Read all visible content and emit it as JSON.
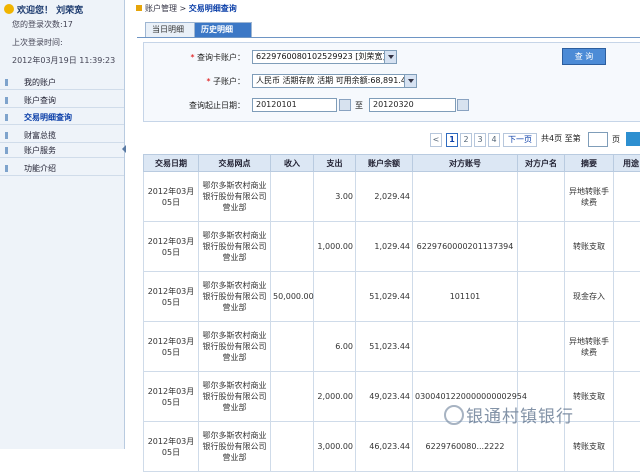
{
  "sidebar": {
    "welcome": "欢迎您！ 刘荣宽",
    "login_count": "您的登录次数:17",
    "last_login_label": "上次登录时间:",
    "last_login_time": "2012年03月19日 11:39:23",
    "items": [
      {
        "label": "我的账户"
      },
      {
        "label": "账户查询"
      },
      {
        "label": "交易明细查询"
      },
      {
        "label": "财富总揽"
      },
      {
        "label": "账户服务"
      },
      {
        "label": "功能介绍"
      }
    ]
  },
  "breadcrumb": {
    "parent": "账户管理",
    "sep": ">",
    "current": "交易明细查询"
  },
  "tabs": [
    {
      "label": "当日明细"
    },
    {
      "label": "历史明细"
    }
  ],
  "form": {
    "card_label": "查询卡账户：",
    "card_value": "6229760080102529923 [刘荣宽]",
    "sub_label": "子账户：",
    "sub_value": "人民币 活期存款 活期 可用余额:68,891.44元",
    "date_label": "查询起止日期：",
    "start_date": "20120101",
    "to": "至",
    "end_date": "20120320",
    "query_button": "查 询"
  },
  "pagination": {
    "prev": "<",
    "pages": [
      "1",
      "2",
      "3",
      "4"
    ],
    "next": "下一页",
    "total": "共4页 至第",
    "page": "页"
  },
  "table": {
    "headers": [
      "交易日期",
      "交易网点",
      "收入",
      "支出",
      "账户余额",
      "对方账号",
      "对方户名",
      "摘要",
      "用途"
    ],
    "rows": [
      [
        "2012年03月05日",
        "鄂尔多斯农村商业银行股份有限公司营业部",
        "",
        "3.00",
        "2,029.44",
        "",
        "",
        "异地转账手续费",
        ""
      ],
      [
        "2012年03月05日",
        "鄂尔多斯农村商业银行股份有限公司营业部",
        "",
        "1,000.00",
        "1,029.44",
        "6229760000201137394",
        "",
        "转账支取",
        ""
      ],
      [
        "2012年03月05日",
        "鄂尔多斯农村商业银行股份有限公司营业部",
        "50,000.00",
        "",
        "51,029.44",
        "101101",
        "",
        "现金存入",
        ""
      ],
      [
        "2012年03月05日",
        "鄂尔多斯农村商业银行股份有限公司营业部",
        "",
        "6.00",
        "51,023.44",
        "",
        "",
        "异地转账手续费",
        ""
      ],
      [
        "2012年03月05日",
        "鄂尔多斯农村商业银行股份有限公司营业部",
        "",
        "2,000.00",
        "49,023.44",
        "0300401220000000002954",
        "",
        "转账支取",
        ""
      ],
      [
        "2012年03月05日",
        "鄂尔多斯农村商业银行股份有限公司营业部",
        "",
        "3,000.00",
        "46,023.44",
        "6229760080...2222",
        "",
        "转账支取",
        ""
      ]
    ]
  },
  "watermark": "银通村镇银行"
}
